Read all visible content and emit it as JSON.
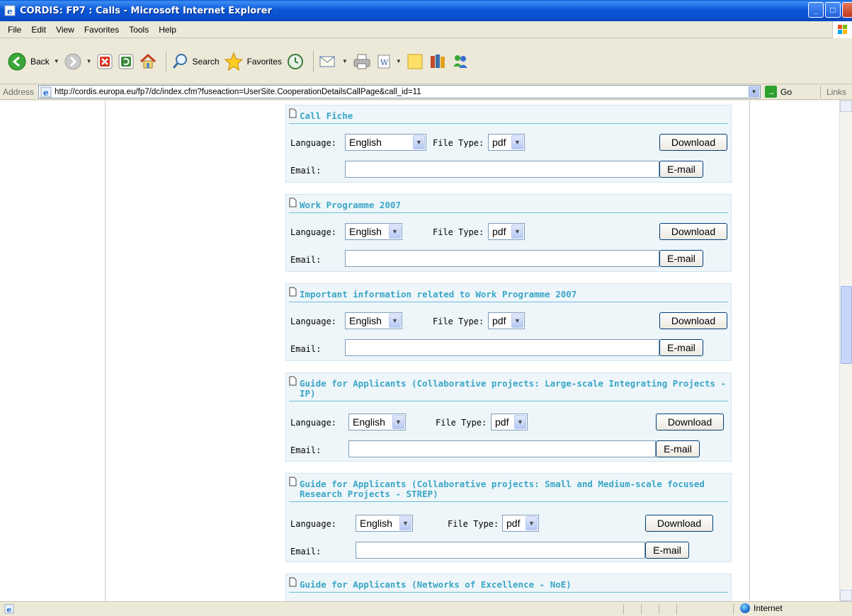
{
  "window": {
    "title": "CORDIS: FP7 : Calls - Microsoft Internet Explorer",
    "minimize": "_",
    "maximize": "□"
  },
  "menubar": {
    "items": [
      "File",
      "Edit",
      "View",
      "Favorites",
      "Tools",
      "Help"
    ]
  },
  "toolbar": {
    "back_label": "Back",
    "search_label": "Search",
    "favorites_label": "Favorites"
  },
  "address": {
    "label": "Address",
    "url": "http://cordis.europa.eu/fp7/dc/index.cfm?fuseaction=UserSite.CooperationDetailsCallPage&call_id=11",
    "go_label": "Go",
    "links_label": "Links"
  },
  "form_labels": {
    "language": "Language:",
    "file_type": "File Type:",
    "email": "Email:",
    "download": "Download",
    "email_button": "E-mail"
  },
  "documents": [
    {
      "title": "Call Fiche",
      "language": "English",
      "file_type": "pdf",
      "email": ""
    },
    {
      "title": "Work Programme 2007",
      "language": "English",
      "file_type": "pdf",
      "email": ""
    },
    {
      "title": "Important information related to Work Programme 2007",
      "language": "English",
      "file_type": "pdf",
      "email": ""
    },
    {
      "title": "Guide for Applicants (Collaborative projects: Large-scale Integrating Projects - IP)",
      "language": "English",
      "file_type": "pdf",
      "email": ""
    },
    {
      "title": "Guide for Applicants (Collaborative projects: Small and Medium-scale focused Research Projects - STREP)",
      "language": "English",
      "file_type": "pdf",
      "email": ""
    },
    {
      "title": "Guide for Applicants (Networks of Excellence - NoE)"
    }
  ],
  "statusbar": {
    "zone": "Internet"
  },
  "colors": {
    "section_bg": "#eef6fa",
    "heading": "#3aa6c6",
    "divider": "#6cc0d6",
    "titlebar": "#0b58d6"
  }
}
